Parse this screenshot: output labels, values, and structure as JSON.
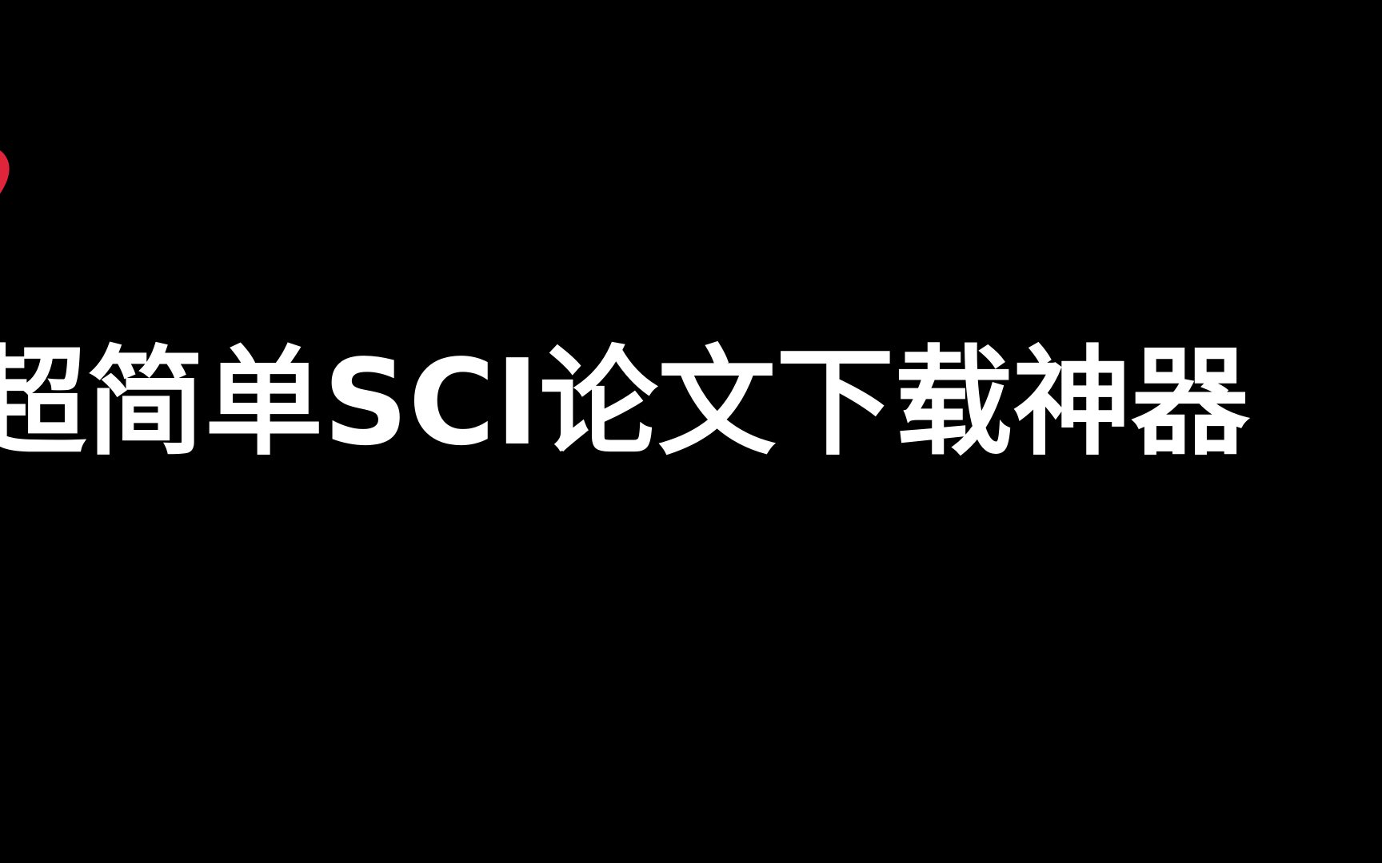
{
  "title": "超简单SCI论文下载神器",
  "icons": {
    "heart": "heart-icon"
  },
  "colors": {
    "background": "#000000",
    "text": "#ffffff",
    "heart": "#e0243a"
  }
}
